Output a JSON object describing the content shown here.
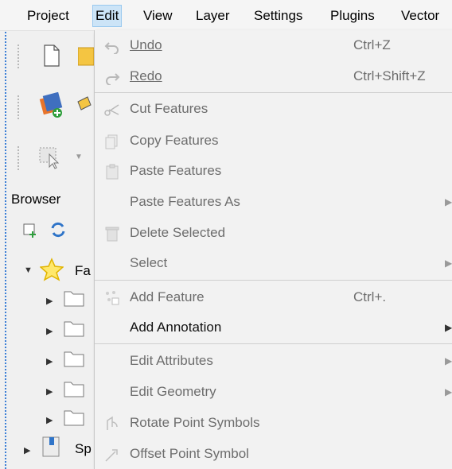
{
  "menubar": {
    "items": [
      "Project",
      "Edit",
      "View",
      "Layer",
      "Settings",
      "Plugins",
      "Vector"
    ]
  },
  "browser": {
    "title": "Browser",
    "favorites_label": "Fa",
    "spatialite_label": "Sp"
  },
  "menu": {
    "undo": {
      "label": "Undo",
      "shortcut": "Ctrl+Z"
    },
    "redo": {
      "label": "Redo",
      "shortcut": "Ctrl+Shift+Z"
    },
    "cut": {
      "label": "Cut Features"
    },
    "copy": {
      "label": "Copy Features"
    },
    "paste": {
      "label": "Paste Features"
    },
    "paste_as": {
      "label": "Paste Features As"
    },
    "delete": {
      "label": "Delete Selected"
    },
    "select": {
      "label": "Select"
    },
    "add_feature": {
      "label": "Add Feature",
      "shortcut": "Ctrl+."
    },
    "add_annotation": {
      "label": "Add Annotation"
    },
    "edit_attributes": {
      "label": "Edit Attributes"
    },
    "edit_geometry": {
      "label": "Edit Geometry"
    },
    "rotate_symbols": {
      "label": "Rotate Point Symbols"
    },
    "offset_symbol": {
      "label": "Offset Point Symbol"
    }
  },
  "colors": {
    "accent": "#cce4f7",
    "menu_bg": "#f2f2f2",
    "disabled_text": "#6d6d6d"
  }
}
